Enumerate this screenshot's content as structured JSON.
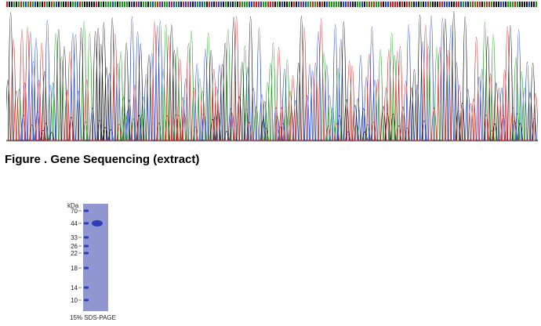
{
  "figure": {
    "caption": "Figure . Gene Sequencing (extract)"
  },
  "chromatogram": {
    "colors": {
      "A": "#1a9a1a",
      "C": "#1f3fcf",
      "G": "#111111",
      "T": "#d02020"
    }
  },
  "gel": {
    "unit_label": "kDa",
    "markers": [
      "70",
      "44",
      "33",
      "26",
      "22",
      "18",
      "14",
      "10"
    ],
    "caption": "15% SDS-PAGE",
    "gel_color": "#8f96d0",
    "band_color": "#2c3fb8"
  }
}
